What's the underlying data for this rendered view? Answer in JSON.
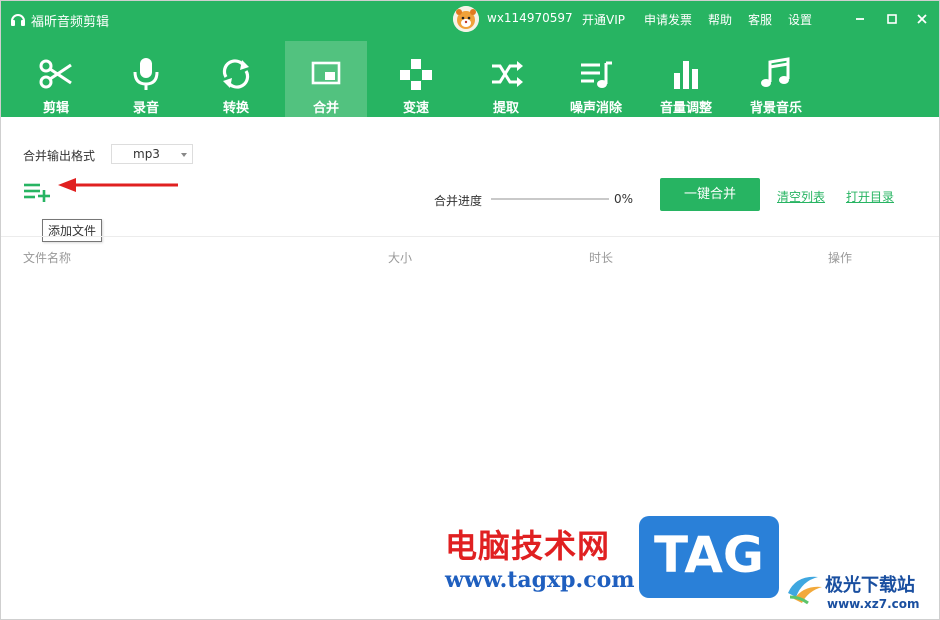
{
  "colors": {
    "brand_green": "#27b462",
    "active_tab_bg": "#52c27f",
    "arrow_red": "#e02020"
  },
  "window": {
    "title": "福昕音频剪辑",
    "username": "wx114970597",
    "links": [
      "开通VIP",
      "申请发票",
      "帮助",
      "客服",
      "设置"
    ]
  },
  "tabs": [
    {
      "label": "剪辑",
      "icon": "scissors-icon"
    },
    {
      "label": "录音",
      "icon": "microphone-icon"
    },
    {
      "label": "转换",
      "icon": "convert-icon"
    },
    {
      "label": "合并",
      "icon": "merge-icon",
      "active": true
    },
    {
      "label": "变速",
      "icon": "speed-icon"
    },
    {
      "label": "提取",
      "icon": "extract-icon"
    },
    {
      "label": "噪声消除",
      "icon": "noise-icon"
    },
    {
      "label": "音量调整",
      "icon": "volume-icon"
    },
    {
      "label": "背景音乐",
      "icon": "music-icon"
    }
  ],
  "merge": {
    "format_label": "合并输出格式",
    "format_value": "mp3",
    "add_tooltip": "添加文件",
    "progress_label": "合并进度",
    "progress_percent": 0,
    "progress_text": "0%",
    "merge_button": "一键合并",
    "clear_link": "清空列表",
    "open_dir_link": "打开目录"
  },
  "table": {
    "columns": [
      "文件名称",
      "大小",
      "时长",
      "操作"
    ],
    "rows": []
  },
  "watermark": {
    "cn_text": "电脑技术网",
    "url": "www.tagxp.com",
    "tag": "TAG",
    "site_name": "极光下载站",
    "site_url": "www.xz7.com"
  }
}
